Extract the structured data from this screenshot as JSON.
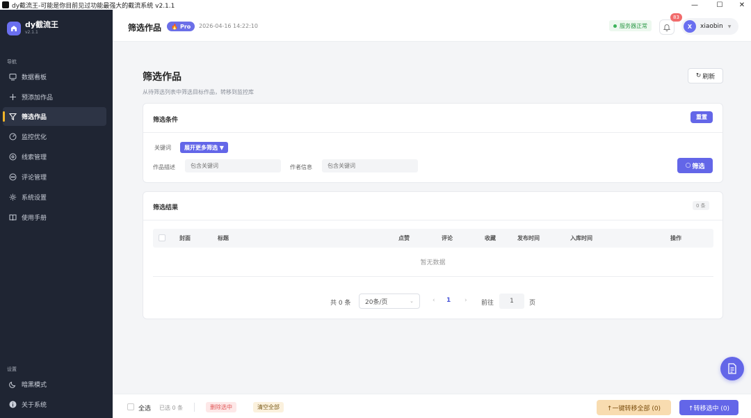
{
  "window": {
    "title": "dy截流王-可能是你目前见过功能最强大的截流系统 v2.1.1"
  },
  "brand": {
    "name": "dy截流王",
    "version": "v2.1.1"
  },
  "sidebar": {
    "nav_label": "导航",
    "items": [
      {
        "label": "数据看板",
        "icon": "dashboard-icon"
      },
      {
        "label": "预添加作品",
        "icon": "plus-icon"
      },
      {
        "label": "筛选作品",
        "icon": "filter-icon",
        "active": true
      },
      {
        "label": "监控优化",
        "icon": "monitor-icon"
      },
      {
        "label": "线索管理",
        "icon": "leads-icon"
      },
      {
        "label": "评论管理",
        "icon": "comment-icon"
      },
      {
        "label": "系统设置",
        "icon": "gear-icon"
      },
      {
        "label": "使用手册",
        "icon": "book-icon"
      }
    ],
    "settings_label": "设置",
    "dark_mode": "暗黑模式",
    "about": "关于系统"
  },
  "topbar": {
    "title": "筛选作品",
    "pro": "Pro",
    "timestamp": "2026-04-16 14:22:10",
    "server_status": "服务器正常",
    "notif_count": "83",
    "user_initial": "X",
    "username": "xiaobin"
  },
  "page": {
    "heading": "筛选作品",
    "subheading": "从待筛选列表中筛选目标作品，转移到监控库",
    "refresh": "刷新"
  },
  "filter": {
    "title": "筛选条件",
    "reset": "重置",
    "keyword_label": "关键词",
    "more_filters": "展开更多筛选 ▼",
    "desc_label": "作品描述",
    "desc_placeholder": "包含关键词",
    "author_label": "作者信息",
    "author_placeholder": "包含关键词",
    "submit": "筛选"
  },
  "results": {
    "title": "筛选结果",
    "count": "0 条",
    "columns": [
      "封面",
      "标题",
      "点赞",
      "评论",
      "收藏",
      "发布时间",
      "入库时间",
      "操作"
    ],
    "empty": "暂无数据",
    "total": "共 0 条",
    "page_size": "20条/页",
    "current_page": "1",
    "goto_label": "前往",
    "goto_value": "1",
    "page_suffix": "页"
  },
  "bottom": {
    "select_all": "全选",
    "selected": "已选 0 条",
    "delete_selected": "删除选中",
    "clear_all": "清空全部",
    "transfer_all": "↑一键转移全部 (0)",
    "transfer_selected": "↑转移选中 (0)"
  },
  "colors": {
    "accent": "#6366e8",
    "sidebar": "#1f2533",
    "active_marker": "#f0b429"
  }
}
